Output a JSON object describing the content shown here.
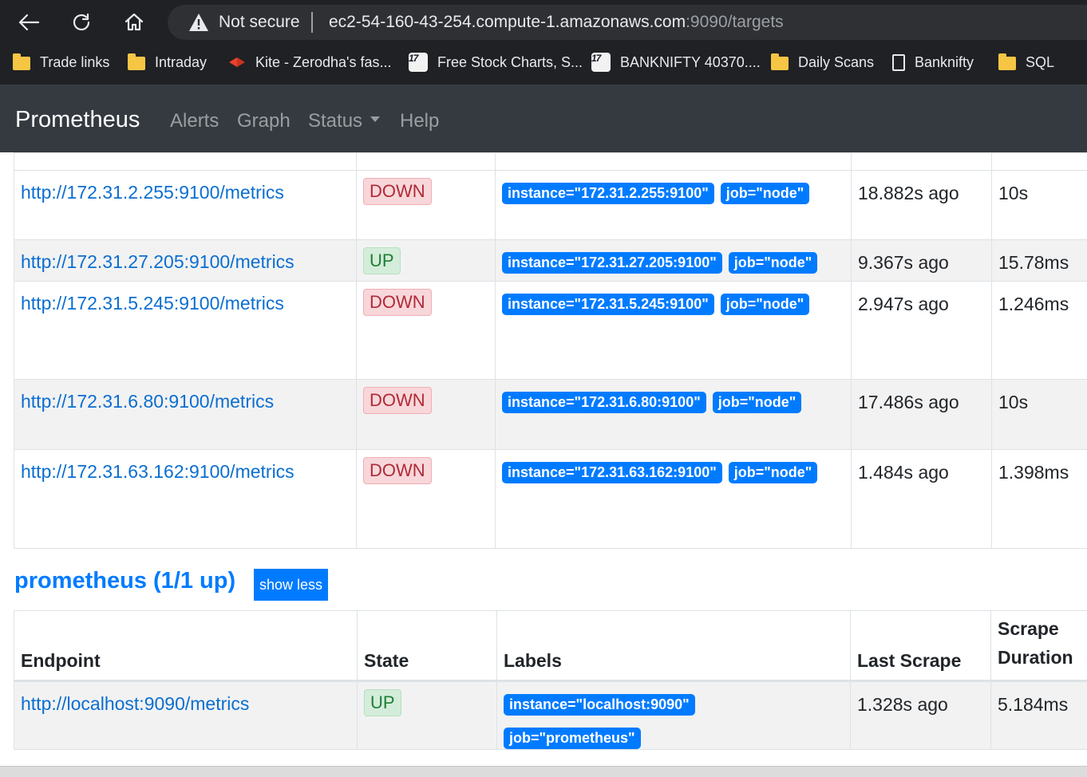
{
  "browser": {
    "security_label": "Not secure",
    "url_host": "ec2-54-160-43-254.compute-1.amazonaws.com",
    "url_rest": ":9090/targets",
    "bookmarks": [
      {
        "label": "Trade links",
        "icon": "folder-icon"
      },
      {
        "label": "Intraday",
        "icon": "folder-icon"
      },
      {
        "label": "Kite - Zerodha's fas...",
        "icon": "kite-icon"
      },
      {
        "label": "Free Stock Charts, S...",
        "icon": "tradingview-icon"
      },
      {
        "label": "BANKNIFTY 40370....",
        "icon": "tradingview-icon"
      },
      {
        "label": "Daily Scans",
        "icon": "folder-icon"
      },
      {
        "label": "Banknifty",
        "icon": "document-icon"
      },
      {
        "label": "SQL",
        "icon": "folder-icon"
      }
    ],
    "tv_glyph": "17"
  },
  "navbar": {
    "brand": "Prometheus",
    "links": [
      "Alerts",
      "Graph",
      "Status",
      "Help"
    ]
  },
  "node_targets": [
    {
      "endpoint": "http://172.31.2.255:9100/metrics",
      "state": "DOWN",
      "labels": [
        "instance=\"172.31.2.255:9100\"",
        "job=\"node\""
      ],
      "last_scrape": "18.882s ago",
      "scrape_duration": "10s"
    },
    {
      "endpoint": "http://172.31.27.205:9100/metrics",
      "state": "UP",
      "labels": [
        "instance=\"172.31.27.205:9100\"",
        "job=\"node\""
      ],
      "last_scrape": "9.367s ago",
      "scrape_duration": "15.78ms"
    },
    {
      "endpoint": "http://172.31.5.245:9100/metrics",
      "state": "DOWN",
      "labels": [
        "instance=\"172.31.5.245:9100\"",
        "job=\"node\""
      ],
      "last_scrape": "2.947s ago",
      "scrape_duration": "1.246ms"
    },
    {
      "endpoint": "http://172.31.6.80:9100/metrics",
      "state": "DOWN",
      "labels": [
        "instance=\"172.31.6.80:9100\"",
        "job=\"node\""
      ],
      "last_scrape": "17.486s ago",
      "scrape_duration": "10s"
    },
    {
      "endpoint": "http://172.31.63.162:9100/metrics",
      "state": "DOWN",
      "labels": [
        "instance=\"172.31.63.162:9100\"",
        "job=\"node\""
      ],
      "last_scrape": "1.484s ago",
      "scrape_duration": "1.398ms"
    }
  ],
  "prometheus_section": {
    "title": "prometheus (1/1 up)",
    "toggle_label": "show less",
    "headers": [
      "Endpoint",
      "State",
      "Labels",
      "Last Scrape",
      "Scrape Duration"
    ],
    "rows": [
      {
        "endpoint": "http://localhost:9090/metrics",
        "state": "UP",
        "labels": [
          "instance=\"localhost:9090\"",
          "job=\"prometheus\""
        ],
        "last_scrape": "1.328s ago",
        "scrape_duration": "5.184ms"
      }
    ]
  },
  "colors": {
    "accent": "#007bff",
    "navbar_bg": "#343a40",
    "down_bg": "#f8d7da",
    "up_bg": "#d4edda"
  }
}
